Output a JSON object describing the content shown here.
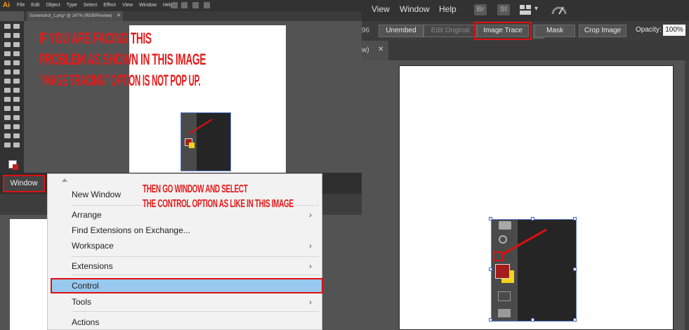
{
  "left_app": {
    "logo": "Ai",
    "menus": [
      "File",
      "Edit",
      "Object",
      "Type",
      "Select",
      "Effect",
      "View",
      "Window",
      "Help"
    ],
    "doc_tab_title": "Screenshot_1.png* @ 147% (RGB/Preview)",
    "tab_close": "✕",
    "window_button_label": "Window"
  },
  "annotations": {
    "top_line1": "If you are facing this",
    "top_line2": "problem as shown in this image",
    "top_line3": "\"Image Tracing\" option is not pop up.",
    "mid_line1": "then go window and select",
    "mid_line2": "the control option as like in this image",
    "color": "#e41b1b"
  },
  "window_menu": {
    "items": [
      {
        "label": "New Window",
        "submenu": false
      },
      {
        "label": "Arrange",
        "submenu": true
      },
      {
        "label": "Find Extensions on Exchange...",
        "submenu": false
      },
      {
        "label": "Workspace",
        "submenu": true
      },
      {
        "label": "Extensions",
        "submenu": true
      },
      {
        "label": "Control",
        "submenu": false,
        "highlighted": true
      },
      {
        "label": "Tools",
        "submenu": true
      },
      {
        "label": "Actions",
        "submenu": false
      }
    ],
    "submenu_chevron": "›",
    "highlight_color": "#99c9ef"
  },
  "right_app": {
    "menus": [
      "View",
      "Window",
      "Help"
    ],
    "icons": [
      "Br",
      "St"
    ],
    "control_bar": {
      "partial_label": "96",
      "unembed": "Unembed",
      "edit_original": "Edit Original",
      "image_trace": "Image Trace",
      "mask": "Mask",
      "crop_image": "Crop Image",
      "opacity_label": "Opacity:",
      "opacity_value": "100%"
    },
    "tab_partial": "w)",
    "tab_close": "✕"
  }
}
